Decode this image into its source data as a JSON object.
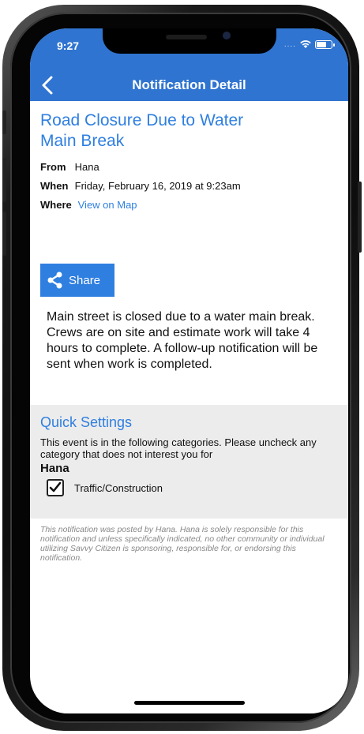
{
  "status": {
    "time": "9:27",
    "signal": "...."
  },
  "nav": {
    "title": "Notification Detail"
  },
  "notification": {
    "title": "Road Closure Due to Water Main Break",
    "from_label": "From",
    "from_value": "Hana",
    "when_label": "When",
    "when_value": "Friday, February 16, 2019 at 9:23am",
    "where_label": "Where",
    "where_value": "View on Map",
    "share_label": "Share",
    "body": "Main street is closed due to a water main break. Crews are on site and estimate work will take 4 hours to complete. A follow-up notification will be sent when work is completed."
  },
  "quick_settings": {
    "title": "Quick Settings",
    "description": "This event is in the following categories. Please uncheck any category that does not interest you for",
    "community": "Hana",
    "category": "Traffic/Construction"
  },
  "disclaimer": "This notification was posted by Hana. Hana is solely responsible for this notification and unless specifically indicated, no other community or individual utilizing Savvy Citizen is sponsoring, responsible for, or endorsing this notification.",
  "colors": {
    "accent": "#2f74d0",
    "link": "#2f7fe0"
  }
}
